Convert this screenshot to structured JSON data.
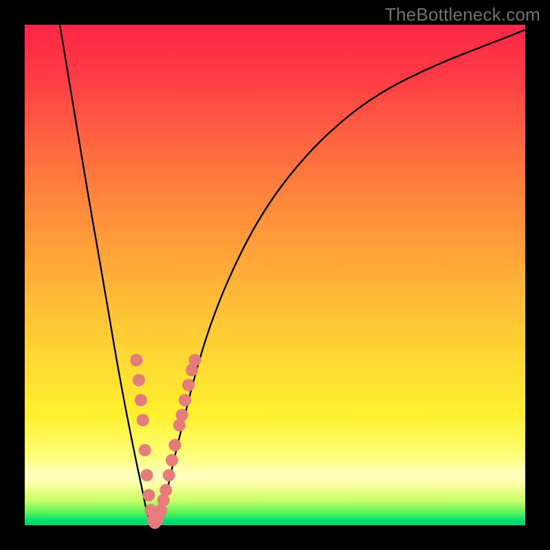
{
  "watermark": "TheBottleneck.com",
  "chart_data": {
    "type": "line",
    "title": "",
    "xlabel": "",
    "ylabel": "",
    "xlim": [
      0,
      100
    ],
    "ylim": [
      0,
      100
    ],
    "series": [
      {
        "name": "curve",
        "x": [
          7,
          10,
          13,
          16,
          18,
          20,
          22,
          23.5,
          24.5,
          25.5,
          27,
          28.5,
          30,
          32,
          34,
          37,
          41,
          46,
          52,
          60,
          70,
          82,
          95,
          100
        ],
        "values": [
          100,
          82,
          64,
          47,
          35,
          24,
          14,
          7,
          2,
          0,
          2,
          7,
          14,
          22,
          30,
          40,
          50,
          60,
          69,
          78,
          86,
          92,
          97,
          99
        ]
      }
    ],
    "highlight_band": {
      "ymin": 0,
      "ymax": 33
    },
    "highlight_dots": [
      {
        "x": 22.3,
        "y": 33
      },
      {
        "x": 22.8,
        "y": 29
      },
      {
        "x": 23.2,
        "y": 25
      },
      {
        "x": 23.6,
        "y": 21
      },
      {
        "x": 24.0,
        "y": 15
      },
      {
        "x": 24.4,
        "y": 10
      },
      {
        "x": 24.8,
        "y": 6
      },
      {
        "x": 25.2,
        "y": 3
      },
      {
        "x": 25.6,
        "y": 1
      },
      {
        "x": 26.0,
        "y": 0.5
      },
      {
        "x": 26.4,
        "y": 1
      },
      {
        "x": 26.8,
        "y": 2
      },
      {
        "x": 27.2,
        "y": 3
      },
      {
        "x": 27.7,
        "y": 5
      },
      {
        "x": 28.2,
        "y": 7
      },
      {
        "x": 28.8,
        "y": 10
      },
      {
        "x": 29.4,
        "y": 13
      },
      {
        "x": 30.0,
        "y": 16
      },
      {
        "x": 30.9,
        "y": 20
      },
      {
        "x": 31.4,
        "y": 22
      },
      {
        "x": 32.0,
        "y": 25
      },
      {
        "x": 32.7,
        "y": 28
      },
      {
        "x": 33.4,
        "y": 31
      },
      {
        "x": 34.0,
        "y": 33
      }
    ],
    "colors": {
      "curve": "#000000",
      "dots": "#e67b7b"
    }
  }
}
